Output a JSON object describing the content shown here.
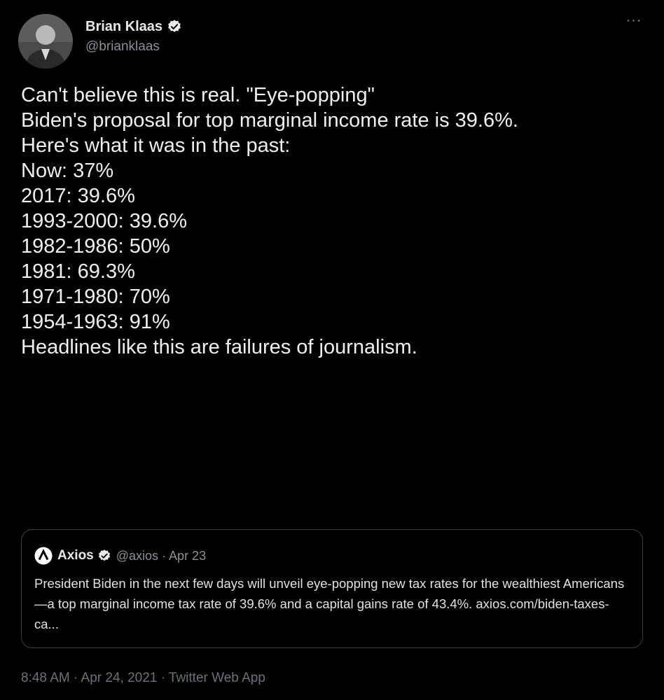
{
  "author": {
    "display_name": "Brian Klaas",
    "handle": "@brianklaas"
  },
  "more_label": "···",
  "tweet": {
    "lines": [
      "Can't believe this is real. \"Eye-popping\"",
      "",
      "Biden's proposal for top marginal income rate is 39.6%.",
      "Here's what it was in the past:",
      "",
      "Now: 37%",
      "2017: 39.6%",
      "1993-2000: 39.6%",
      "1982-1986: 50%",
      "1981: 69.3%",
      "1971-1980: 70%",
      "1954-1963: 91%",
      "",
      "Headlines like this are failures of journalism."
    ]
  },
  "quoted_tweet": {
    "display_name": "Axios",
    "meta": "@axios · Apr 23",
    "body": "President Biden in the next few days will unveil eye-popping new tax rates for the wealthiest Americans —a top marginal income tax rate of 39.6% and a capital gains rate of 43.4%. axios.com/biden-taxes-ca..."
  },
  "timestamp": "8:48 AM · Apr 24, 2021 · Twitter Web App",
  "colors": {
    "background": "#000000",
    "verified": "#e7e9ea",
    "muted": "#8a8f94"
  },
  "icons": {
    "avatar": "profile-photo",
    "verified": "verified-badge-icon",
    "more": "more-horizontal-icon",
    "quote_logo": "axios-logo-icon"
  }
}
